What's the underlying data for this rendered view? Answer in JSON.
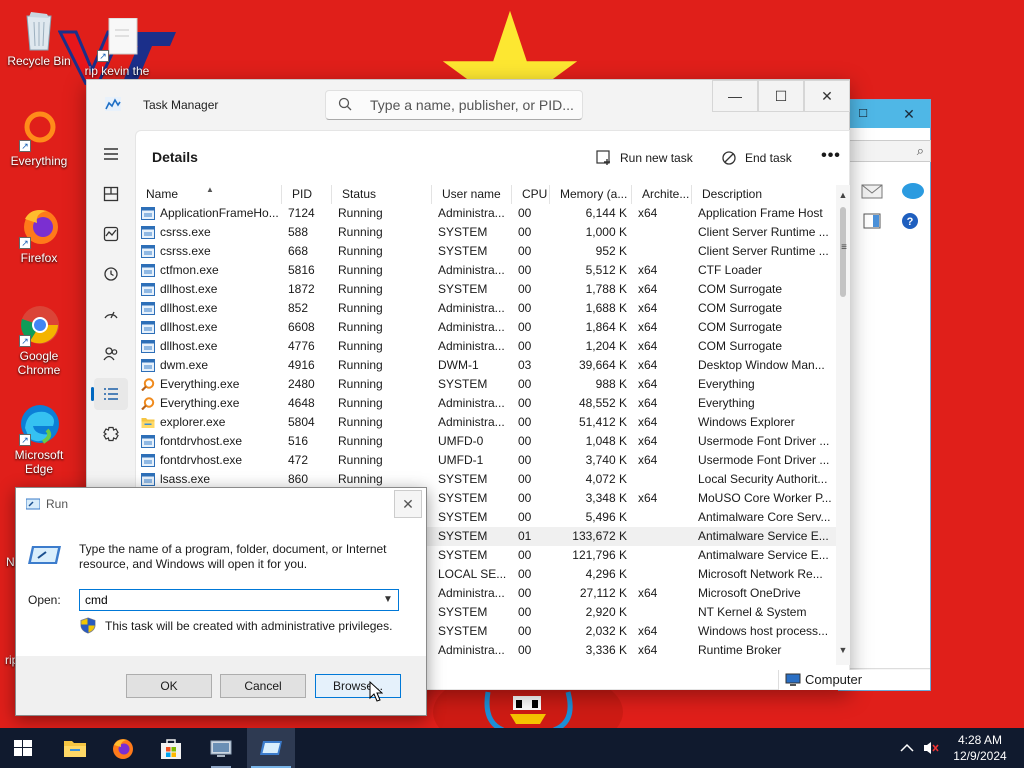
{
  "desktop": {
    "icons": [
      {
        "label": "Recycle Bin",
        "icon": "recycle-bin-icon"
      },
      {
        "label": "rip kevin the",
        "icon": "file-shortcut-icon"
      },
      {
        "label": "Everything",
        "icon": "everything-icon"
      },
      {
        "label": "Firefox",
        "icon": "firefox-icon"
      },
      {
        "label": "Google Chrome",
        "icon": "chrome-icon"
      },
      {
        "label": "Microsoft Edge",
        "icon": "edge-icon"
      }
    ],
    "partial_labels": [
      "N",
      "rip"
    ]
  },
  "task_manager": {
    "title": "Task Manager",
    "search_placeholder": "Type a name, publisher, or PID...",
    "window_controls": {
      "minimize": "—",
      "maximize": "☐",
      "close": "✕"
    },
    "nav": [
      "menu-icon",
      "processes-icon",
      "performance-icon",
      "app-history-icon",
      "startup-apps-icon",
      "users-icon",
      "details-icon",
      "services-icon"
    ],
    "active_nav": "details-icon",
    "heading": "Details",
    "run_new_task": "Run new task",
    "end_task": "End task",
    "more": "•••",
    "columns": [
      "Name",
      "PID",
      "Status",
      "User name",
      "CPU",
      "Memory (a...",
      "Archite...",
      "Description"
    ],
    "rows": [
      {
        "name": "ApplicationFrameHo...",
        "pid": "7124",
        "status": "Running",
        "user": "Administra...",
        "cpu": "00",
        "mem": "6,144 K",
        "arch": "x64",
        "desc": "Application Frame Host",
        "icon": "app-icon"
      },
      {
        "name": "csrss.exe",
        "pid": "588",
        "status": "Running",
        "user": "SYSTEM",
        "cpu": "00",
        "mem": "1,000 K",
        "arch": "",
        "desc": "Client Server Runtime ...",
        "icon": "app-icon"
      },
      {
        "name": "csrss.exe",
        "pid": "668",
        "status": "Running",
        "user": "SYSTEM",
        "cpu": "00",
        "mem": "952 K",
        "arch": "",
        "desc": "Client Server Runtime ...",
        "icon": "app-icon"
      },
      {
        "name": "ctfmon.exe",
        "pid": "5816",
        "status": "Running",
        "user": "Administra...",
        "cpu": "00",
        "mem": "5,512 K",
        "arch": "x64",
        "desc": "CTF Loader",
        "icon": "app-icon"
      },
      {
        "name": "dllhost.exe",
        "pid": "1872",
        "status": "Running",
        "user": "SYSTEM",
        "cpu": "00",
        "mem": "1,788 K",
        "arch": "x64",
        "desc": "COM Surrogate",
        "icon": "app-icon"
      },
      {
        "name": "dllhost.exe",
        "pid": "852",
        "status": "Running",
        "user": "Administra...",
        "cpu": "00",
        "mem": "1,688 K",
        "arch": "x64",
        "desc": "COM Surrogate",
        "icon": "app-icon"
      },
      {
        "name": "dllhost.exe",
        "pid": "6608",
        "status": "Running",
        "user": "Administra...",
        "cpu": "00",
        "mem": "1,864 K",
        "arch": "x64",
        "desc": "COM Surrogate",
        "icon": "app-icon"
      },
      {
        "name": "dllhost.exe",
        "pid": "4776",
        "status": "Running",
        "user": "Administra...",
        "cpu": "00",
        "mem": "1,204 K",
        "arch": "x64",
        "desc": "COM Surrogate",
        "icon": "app-icon"
      },
      {
        "name": "dwm.exe",
        "pid": "4916",
        "status": "Running",
        "user": "DWM-1",
        "cpu": "03",
        "mem": "39,664 K",
        "arch": "x64",
        "desc": "Desktop Window Man...",
        "icon": "app-icon"
      },
      {
        "name": "Everything.exe",
        "pid": "2480",
        "status": "Running",
        "user": "SYSTEM",
        "cpu": "00",
        "mem": "988 K",
        "arch": "x64",
        "desc": "Everything",
        "icon": "everything-icon"
      },
      {
        "name": "Everything.exe",
        "pid": "4648",
        "status": "Running",
        "user": "Administra...",
        "cpu": "00",
        "mem": "48,552 K",
        "arch": "x64",
        "desc": "Everything",
        "icon": "everything-icon"
      },
      {
        "name": "explorer.exe",
        "pid": "5804",
        "status": "Running",
        "user": "Administra...",
        "cpu": "00",
        "mem": "51,412 K",
        "arch": "x64",
        "desc": "Windows Explorer",
        "icon": "folder-icon"
      },
      {
        "name": "fontdrvhost.exe",
        "pid": "516",
        "status": "Running",
        "user": "UMFD-0",
        "cpu": "00",
        "mem": "1,048 K",
        "arch": "x64",
        "desc": "Usermode Font Driver ...",
        "icon": "app-icon"
      },
      {
        "name": "fontdrvhost.exe",
        "pid": "472",
        "status": "Running",
        "user": "UMFD-1",
        "cpu": "00",
        "mem": "3,740 K",
        "arch": "x64",
        "desc": "Usermode Font Driver ...",
        "icon": "app-icon"
      },
      {
        "name": "lsass.exe",
        "pid": "860",
        "status": "Running",
        "user": "SYSTEM",
        "cpu": "00",
        "mem": "4,072 K",
        "arch": "",
        "desc": "Local Security Authorit...",
        "icon": "app-icon"
      },
      {
        "name": "",
        "pid": "",
        "status": "",
        "user": "SYSTEM",
        "cpu": "00",
        "mem": "3,348 K",
        "arch": "x64",
        "desc": "MoUSO Core Worker P...",
        "icon": ""
      },
      {
        "name": "",
        "pid": "",
        "status": "",
        "user": "SYSTEM",
        "cpu": "00",
        "mem": "5,496 K",
        "arch": "",
        "desc": "Antimalware Core Serv...",
        "icon": ""
      },
      {
        "name": "",
        "pid": "",
        "status": "",
        "user": "SYSTEM",
        "cpu": "01",
        "mem": "133,672 K",
        "arch": "",
        "desc": "Antimalware Service E...",
        "icon": ""
      },
      {
        "name": "",
        "pid": "",
        "status": "",
        "user": "SYSTEM",
        "cpu": "00",
        "mem": "121,796 K",
        "arch": "",
        "desc": "Antimalware Service E...",
        "icon": ""
      },
      {
        "name": "",
        "pid": "",
        "status": "",
        "user": "LOCAL SE...",
        "cpu": "00",
        "mem": "4,296 K",
        "arch": "",
        "desc": "Microsoft Network Re...",
        "icon": ""
      },
      {
        "name": "",
        "pid": "",
        "status": "",
        "user": "Administra...",
        "cpu": "00",
        "mem": "27,112 K",
        "arch": "x64",
        "desc": "Microsoft OneDrive",
        "icon": ""
      },
      {
        "name": "",
        "pid": "",
        "status": "",
        "user": "SYSTEM",
        "cpu": "00",
        "mem": "2,920 K",
        "arch": "",
        "desc": "NT Kernel & System",
        "icon": ""
      },
      {
        "name": "",
        "pid": "",
        "status": "",
        "user": "SYSTEM",
        "cpu": "00",
        "mem": "2,032 K",
        "arch": "x64",
        "desc": "Windows host process...",
        "icon": ""
      },
      {
        "name": "",
        "pid": "",
        "status": "",
        "user": "Administra...",
        "cpu": "00",
        "mem": "3,336 K",
        "arch": "x64",
        "desc": "Runtime Broker",
        "icon": ""
      }
    ],
    "selected_row": 17
  },
  "explorer_status": "Computer",
  "run_dialog": {
    "title": "Run",
    "close": "✕",
    "description": "Type the name of a program, folder, document, or Internet resource, and Windows will open it for you.",
    "open_label": "Open:",
    "open_value": "cmd",
    "admin_note": "This task will be created with administrative privileges.",
    "ok": "OK",
    "cancel": "Cancel",
    "browse": "Browse..."
  },
  "taskbar": {
    "items": [
      "start-icon",
      "file-explorer-icon",
      "firefox-icon",
      "store-icon",
      "computer-icon",
      "task-manager-icon"
    ],
    "time": "4:28 AM",
    "date": "12/9/2024"
  }
}
